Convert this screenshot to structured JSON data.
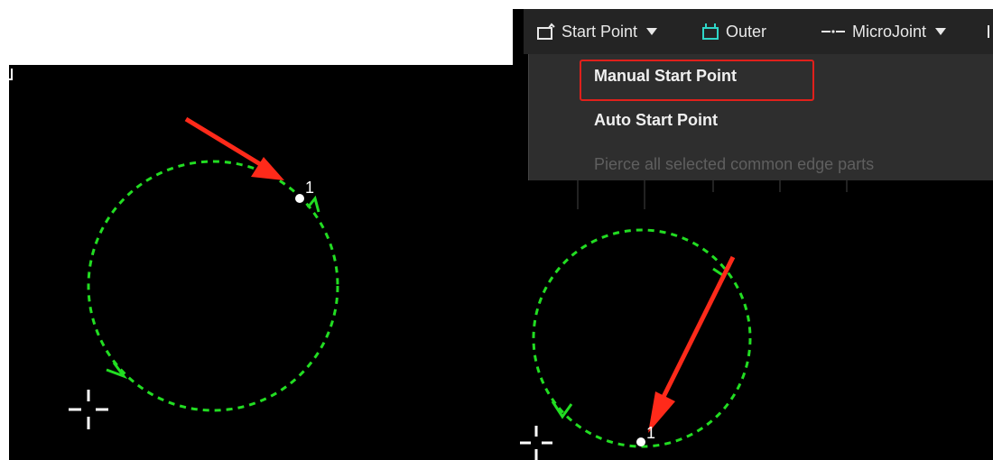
{
  "left_view": {
    "start_point_label": "1"
  },
  "right_view": {
    "toolbar": {
      "start_point_label": "Start Point",
      "outer_label": "Outer",
      "microjoint_label": "MicroJoint"
    },
    "start_point_menu": {
      "items": [
        {
          "label": "Manual Start Point",
          "enabled": true,
          "highlighted": true
        },
        {
          "label": "Auto Start Point",
          "enabled": true
        },
        {
          "label": "Pierce all selected common edge parts",
          "enabled": false
        }
      ]
    },
    "start_point_label": "1"
  },
  "colors": {
    "canvas": "#000000",
    "toolpath": "#22dd22",
    "annotation_arrow": "#ff2a1a",
    "highlight_box": "#e0201b",
    "toolbar_bg": "#242424",
    "menu_bg": "#2e2e2e"
  }
}
